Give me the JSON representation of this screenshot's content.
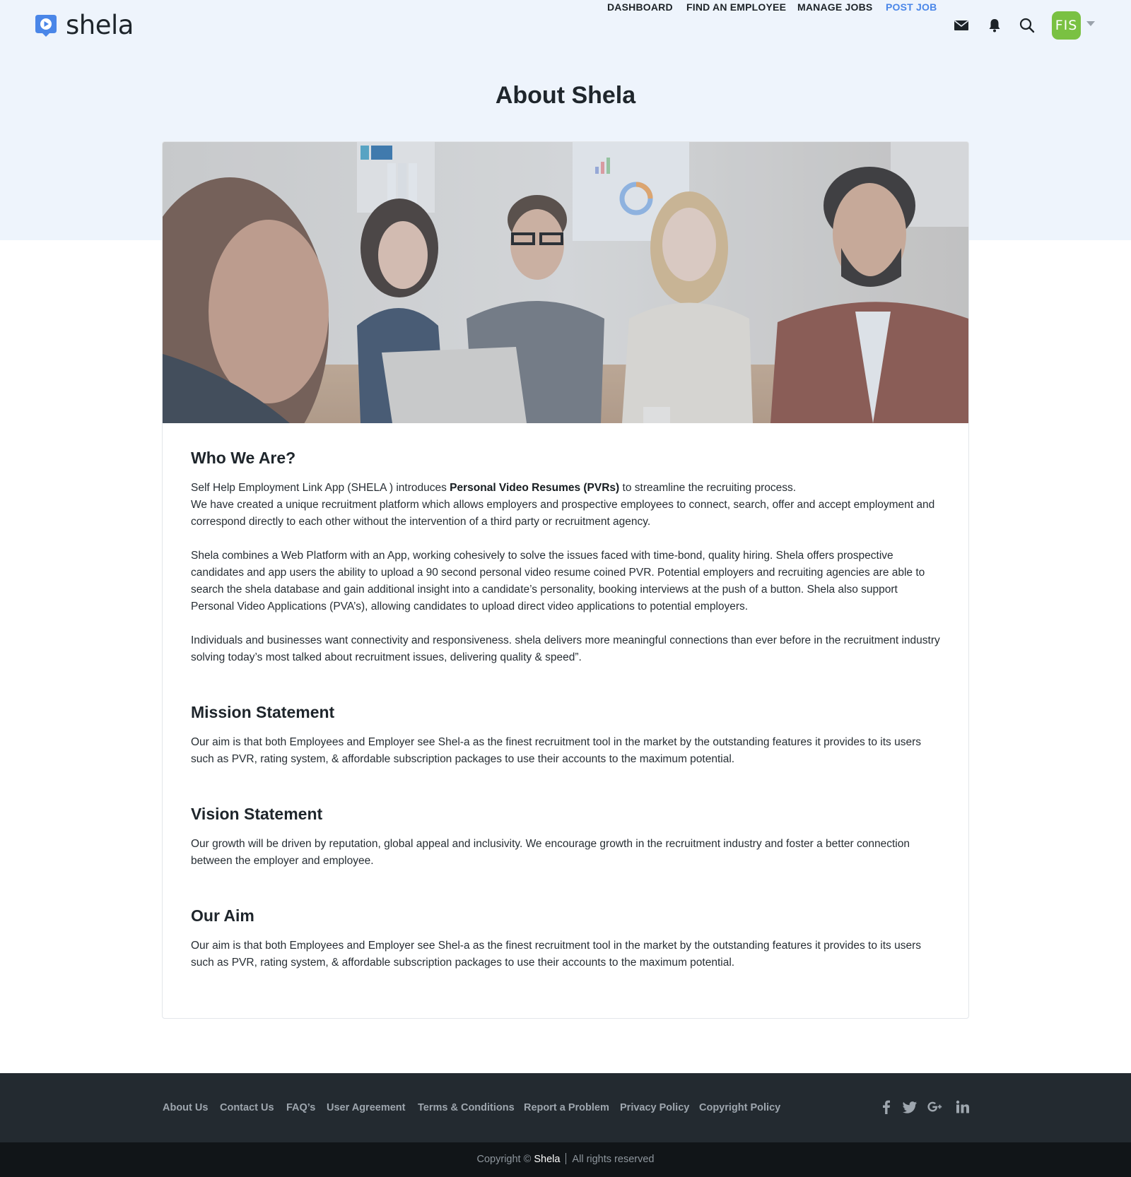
{
  "header": {
    "logo_text": "shela",
    "nav": [
      {
        "label": "DASHBOARD"
      },
      {
        "label": "FIND AN EMPLOYEE"
      },
      {
        "label": "MANAGE JOBS"
      },
      {
        "label": "POST JOB"
      }
    ],
    "accent_color": "#4a86e8",
    "icons": [
      "mail-icon",
      "bell-icon",
      "search-icon"
    ],
    "avatar_text": "FIS",
    "avatar_color": "#7ac142"
  },
  "page": {
    "title": "About Shela",
    "hero_image": "team-meeting-photo"
  },
  "sections": {
    "who": {
      "title": "Who We Are?",
      "p1_prefix": "Self Help Employment Link App (SHELA ) introduces ",
      "p1_bold": "Personal Video Resumes (PVRs)",
      "p1_suffix": " to streamline the recruiting process.",
      "p1_line2": "We have created a unique recruitment platform which allows employers and prospective employees to connect, search, offer and accept employment and correspond directly to each other without the intervention of a third party or recruitment agency.",
      "p2": "Shela combines a Web Platform with an App, working cohesively to solve the issues faced with time-bond, quality hiring. Shela offers prospective candidates and app users the ability to upload a 90 second personal video resume coined PVR. Potential employers and recruiting agencies are able to search the shela database and gain additional insight into a candidate’s personality, booking interviews at the push of a button. Shela also support Personal Video Applications (PVA’s), allowing candidates to upload direct video applications to potential employers.",
      "p3": "Individuals and businesses want connectivity and responsiveness. shela delivers more meaningful connections than ever before in the recruitment industry solving today’s most talked about recruitment issues, delivering quality & speed”."
    },
    "mission": {
      "title": "Mission Statement",
      "text": "Our aim is that both Employees and Employer see Shel-a as the finest recruitment tool in the market by the outstanding features it provides to its users such as PVR, rating system, & affordable subscription packages to use their accounts to the maximum potential."
    },
    "vision": {
      "title": "Vision Statement",
      "text": "Our growth will be driven by reputation, global appeal and inclusivity. We encourage growth in the recruitment industry and foster a better connection between the employer and employee."
    },
    "aim": {
      "title": "Our Aim",
      "text": "Our aim is that both Employees and Employer see Shel-a as the finest recruitment tool in the market by the outstanding features it provides to its users such as PVR, rating system, & affordable subscription packages to use their accounts to the maximum potential."
    }
  },
  "footer": {
    "links": [
      {
        "label": "About Us"
      },
      {
        "label": "Contact Us"
      },
      {
        "label": "FAQ’s"
      },
      {
        "label": "User Agreement"
      },
      {
        "label": "Terms & Conditions"
      },
      {
        "label": "Report a Problem"
      },
      {
        "label": "Privacy Policy"
      },
      {
        "label": "Copyright Policy"
      }
    ],
    "social_icons": [
      "facebook-icon",
      "twitter-icon",
      "google-plus-icon",
      "linkedin-icon"
    ],
    "copyright_prefix": "Copyright © ",
    "copyright_brand": "Shela",
    "copyright_suffix": "All rights reserved"
  }
}
